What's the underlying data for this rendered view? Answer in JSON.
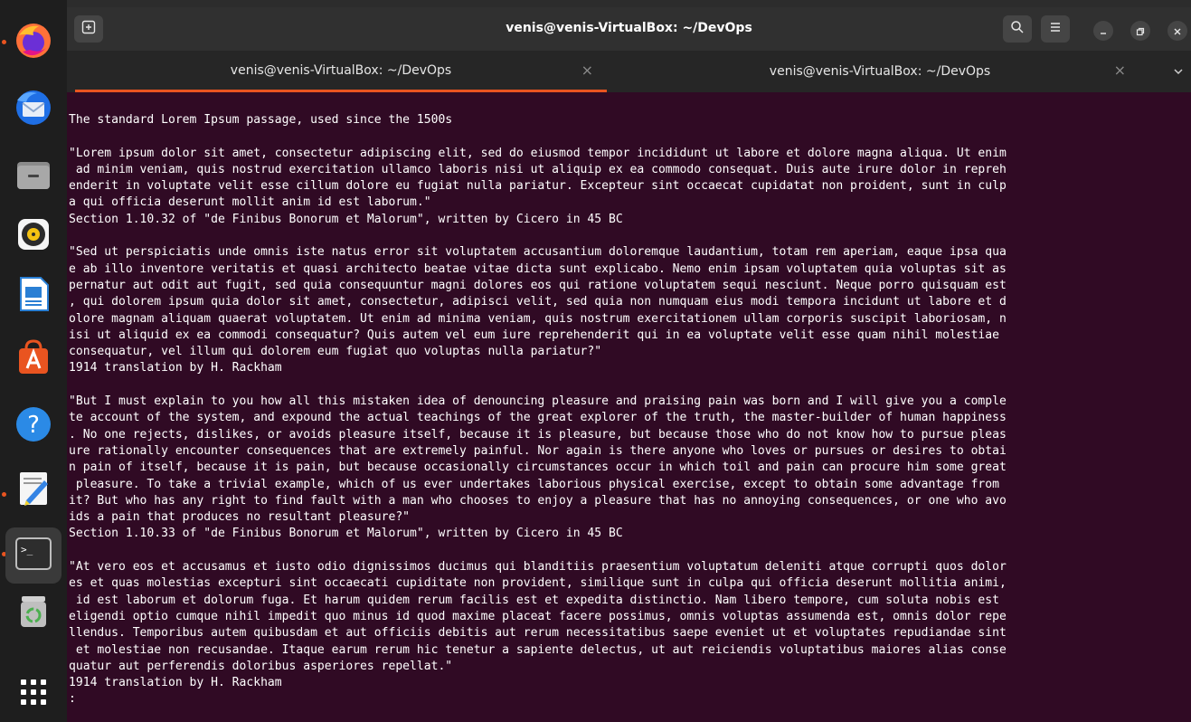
{
  "window": {
    "title": "venis@venis-VirtualBox: ~/DevOps",
    "tabs": [
      {
        "label": "venis@venis-VirtualBox: ~/DevOps",
        "close": "×"
      },
      {
        "label": "venis@venis-VirtualBox: ~/DevOps",
        "close": "×"
      }
    ],
    "tab_dropdown": "⌄"
  },
  "dock": {
    "items": [
      "firefox-icon",
      "thunderbird-icon",
      "files-icon",
      "rhythmbox-icon",
      "libreoffice-writer-icon",
      "app-center-icon",
      "help-icon",
      "text-editor-icon",
      "terminal-icon",
      "trash-icon",
      "app-grid-icon"
    ],
    "terminal_glyph": ">_"
  },
  "colors": {
    "accent": "#e95420",
    "terminal_bg": "#300a24"
  },
  "terminal": {
    "lines": [
      "The standard Lorem Ipsum passage, used since the 1500s",
      "",
      "\"Lorem ipsum dolor sit amet, consectetur adipiscing elit, sed do eiusmod tempor incididunt ut labore et dolore magna aliqua. Ut enim",
      " ad minim veniam, quis nostrud exercitation ullamco laboris nisi ut aliquip ex ea commodo consequat. Duis aute irure dolor in repreh",
      "enderit in voluptate velit esse cillum dolore eu fugiat nulla pariatur. Excepteur sint occaecat cupidatat non proident, sunt in culp",
      "a qui officia deserunt mollit anim id est laborum.\"",
      "Section 1.10.32 of \"de Finibus Bonorum et Malorum\", written by Cicero in 45 BC",
      "",
      "\"Sed ut perspiciatis unde omnis iste natus error sit voluptatem accusantium doloremque laudantium, totam rem aperiam, eaque ipsa qua",
      "e ab illo inventore veritatis et quasi architecto beatae vitae dicta sunt explicabo. Nemo enim ipsam voluptatem quia voluptas sit as",
      "pernatur aut odit aut fugit, sed quia consequuntur magni dolores eos qui ratione voluptatem sequi nesciunt. Neque porro quisquam est",
      ", qui dolorem ipsum quia dolor sit amet, consectetur, adipisci velit, sed quia non numquam eius modi tempora incidunt ut labore et d",
      "olore magnam aliquam quaerat voluptatem. Ut enim ad minima veniam, quis nostrum exercitationem ullam corporis suscipit laboriosam, n",
      "isi ut aliquid ex ea commodi consequatur? Quis autem vel eum iure reprehenderit qui in ea voluptate velit esse quam nihil molestiae ",
      "consequatur, vel illum qui dolorem eum fugiat quo voluptas nulla pariatur?\"",
      "1914 translation by H. Rackham",
      "",
      "\"But I must explain to you how all this mistaken idea of denouncing pleasure and praising pain was born and I will give you a comple",
      "te account of the system, and expound the actual teachings of the great explorer of the truth, the master-builder of human happiness",
      ". No one rejects, dislikes, or avoids pleasure itself, because it is pleasure, but because those who do not know how to pursue pleas",
      "ure rationally encounter consequences that are extremely painful. Nor again is there anyone who loves or pursues or desires to obtai",
      "n pain of itself, because it is pain, but because occasionally circumstances occur in which toil and pain can procure him some great",
      " pleasure. To take a trivial example, which of us ever undertakes laborious physical exercise, except to obtain some advantage from ",
      "it? But who has any right to find fault with a man who chooses to enjoy a pleasure that has no annoying consequences, or one who avo",
      "ids a pain that produces no resultant pleasure?\"",
      "Section 1.10.33 of \"de Finibus Bonorum et Malorum\", written by Cicero in 45 BC",
      "",
      "\"At vero eos et accusamus et iusto odio dignissimos ducimus qui blanditiis praesentium voluptatum deleniti atque corrupti quos dolor",
      "es et quas molestias excepturi sint occaecati cupiditate non provident, similique sunt in culpa qui officia deserunt mollitia animi,",
      " id est laborum et dolorum fuga. Et harum quidem rerum facilis est et expedita distinctio. Nam libero tempore, cum soluta nobis est ",
      "eligendi optio cumque nihil impedit quo minus id quod maxime placeat facere possimus, omnis voluptas assumenda est, omnis dolor repe",
      "llendus. Temporibus autem quibusdam et aut officiis debitis aut rerum necessitatibus saepe eveniet ut et voluptates repudiandae sint",
      " et molestiae non recusandae. Itaque earum rerum hic tenetur a sapiente delectus, ut aut reiciendis voluptatibus maiores alias conse",
      "quatur aut perferendis doloribus asperiores repellat.\"",
      "1914 translation by H. Rackham",
      ":"
    ]
  }
}
